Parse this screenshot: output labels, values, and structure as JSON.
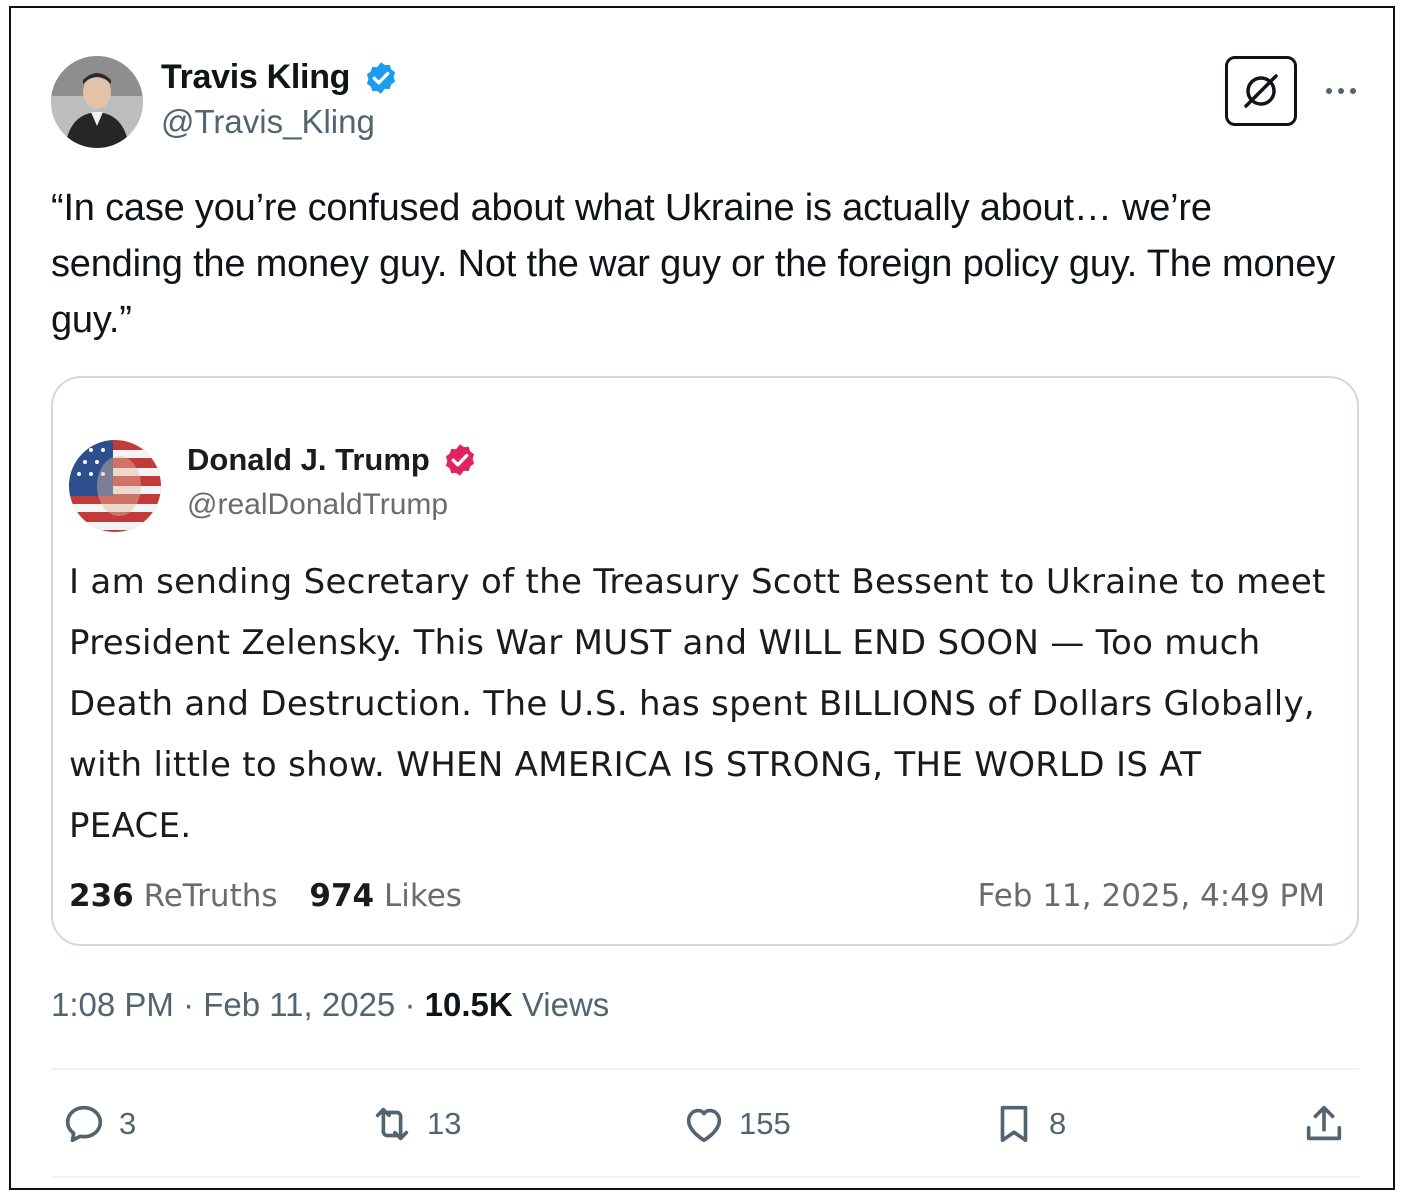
{
  "author": {
    "display_name": "Travis Kling",
    "handle": "@Travis_Kling",
    "avatar_icon": "person-photo-avatar",
    "verified": true
  },
  "tweet": {
    "text": "“In case you’re confused about what Ukraine is actually about… we’re sending the money guy. Not the war guy or the foreign policy guy. The money guy.”"
  },
  "quoted_post": {
    "display_name": "Donald J. Trump",
    "handle": "@realDonaldTrump",
    "text": "I am sending Secretary of the Treasury Scott Bessent to Ukraine to meet President Zelensky. This War MUST and WILL END SOON — Too much Death and Destruction. The U.S. has spent BILLIONS of Dollars Globally, with little to show. WHEN AMERICA IS STRONG, THE WORLD IS AT PEACE.",
    "retruths_count": "236",
    "retruths_label": "ReTruths",
    "likes_count": "974",
    "likes_label": "Likes",
    "date": "Feb 11, 2025, 4:49 PM",
    "verified_color": "#e0245e"
  },
  "meta": {
    "time": "1:08 PM",
    "separator": "·",
    "date": "Feb 11, 2025",
    "views_count": "10.5K",
    "views_label": "Views"
  },
  "actions": {
    "reply_count": "3",
    "repost_count": "13",
    "like_count": "155",
    "bookmark_count": "8"
  },
  "colors": {
    "verified_blue": "#1d9bf0",
    "text_primary": "#0f1419",
    "text_secondary": "#536471"
  }
}
